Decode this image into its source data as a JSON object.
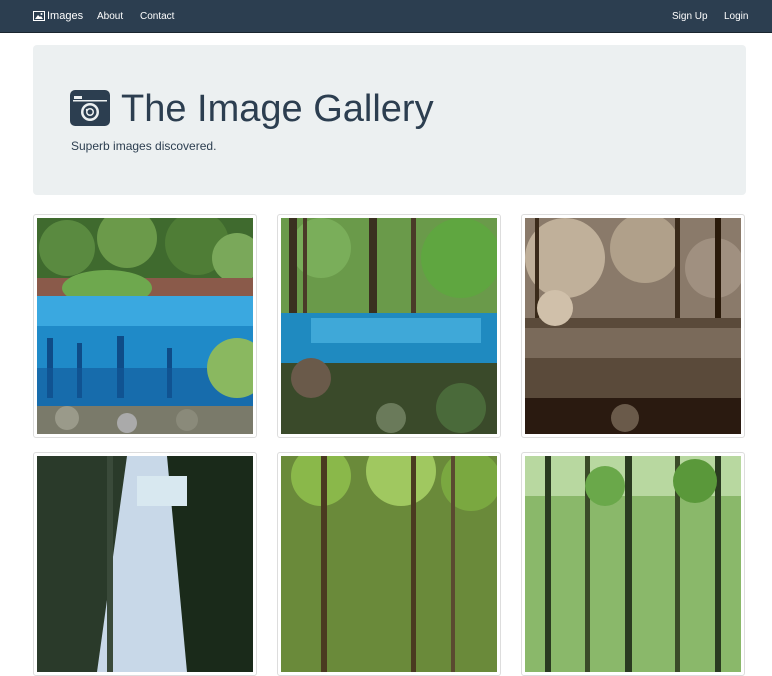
{
  "navbar": {
    "brand": "Images",
    "links": [
      "About",
      "Contact"
    ],
    "right_links": [
      "Sign Up",
      "Login"
    ],
    "brand_icon": "image-icon"
  },
  "jumbotron": {
    "title": "The Image Gallery",
    "subtitle": "Superb images discovered.",
    "icon": "camera-icon"
  },
  "gallery": {
    "items": [
      {
        "name": "blue-lake-forest-photo"
      },
      {
        "name": "blue-lake-tall-trees-photo"
      },
      {
        "name": "sepia-lake-forest-photo"
      },
      {
        "name": "tall-trees-sky-photo"
      },
      {
        "name": "green-forest-photo"
      },
      {
        "name": "green-trees-photo"
      }
    ]
  },
  "colors": {
    "navbar_bg": "#2c3e50",
    "jumbotron_bg": "#ecf0f1",
    "text": "#2c3e50"
  }
}
